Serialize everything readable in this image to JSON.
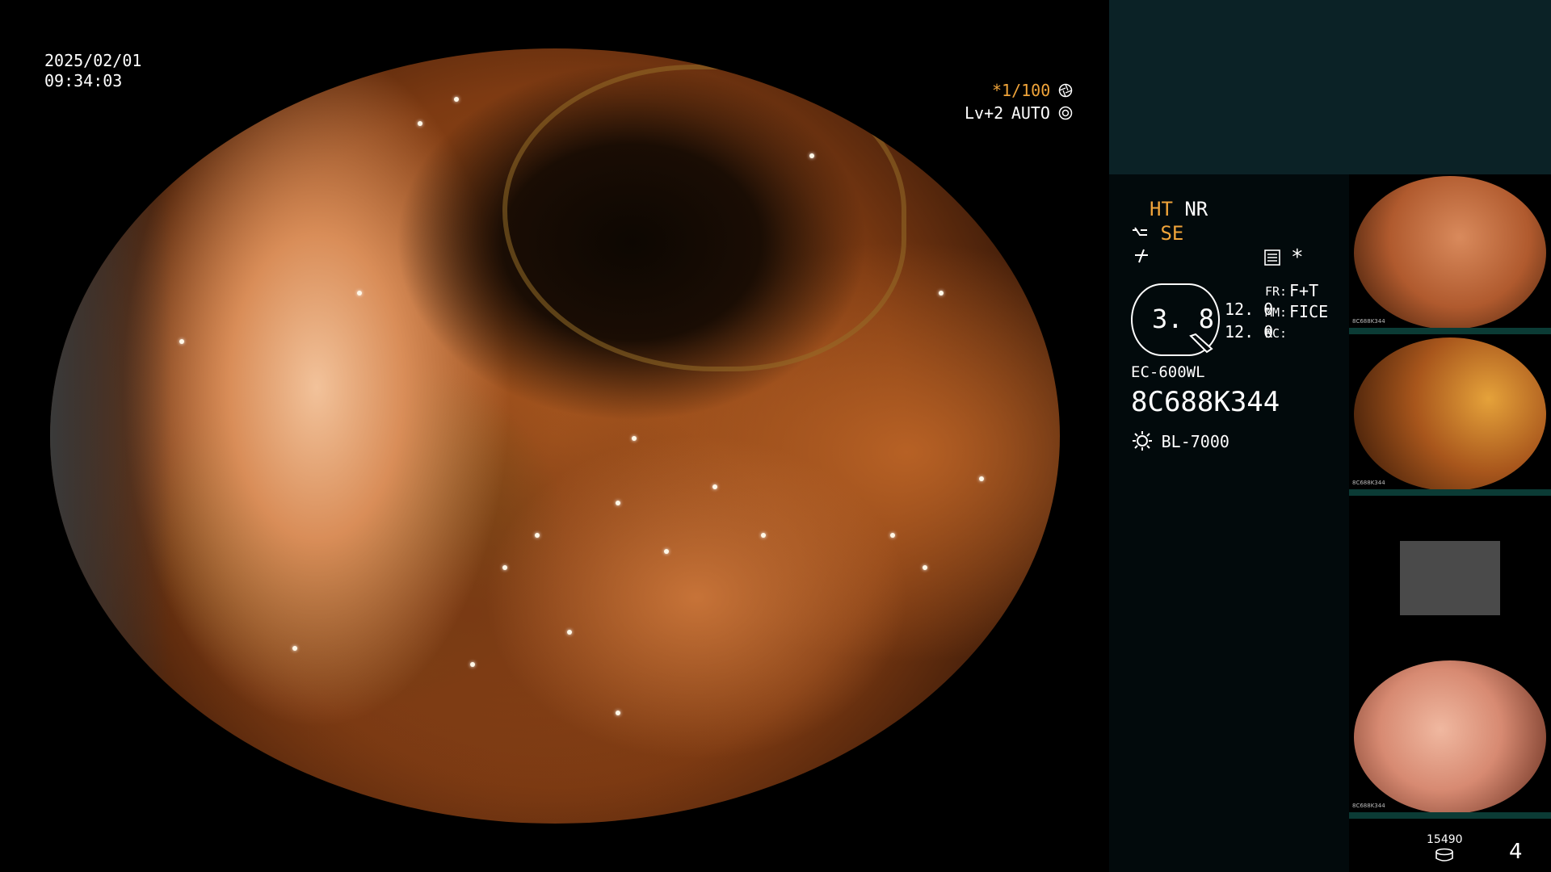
{
  "overlay": {
    "date": "2025/02/01",
    "time": "09:34:03",
    "shutter": "*1/100",
    "shutter_icon": "aperture-icon",
    "level": "Lv+2",
    "mode": "AUTO",
    "mode_icon": "auto-exposure-icon"
  },
  "panel": {
    "ht": "HT",
    "nr": "NR",
    "se": "SE",
    "se_icon": "structure-enhance-icon",
    "flat_icon": "flat-signal-icon",
    "memo_icon": "settings-list-icon",
    "asterisk": "*",
    "zoom": "3. 8",
    "val1": "12. 0",
    "val2": "12. 0",
    "fr_label": "FR:",
    "fr_value": "F+T",
    "mm_label": "MM:",
    "mm_value": "FICE",
    "rc_label": "RC:",
    "scope_model": "EC-600WL",
    "serial": "8C688K344",
    "light_icon": "light-source-icon",
    "light_model": "BL-7000"
  },
  "thumbs": [
    {
      "label": "8C688K344"
    },
    {
      "label": "8C688K344"
    },
    {
      "label": ""
    },
    {
      "label": "8C688K344"
    }
  ],
  "footer": {
    "count": "15490",
    "storage_icon": "disk-storage-icon",
    "index": "4"
  },
  "colors": {
    "accent_orange": "#f0a43a",
    "panel_band": "#0b2226",
    "thumb_separator": "#0b3b35"
  }
}
